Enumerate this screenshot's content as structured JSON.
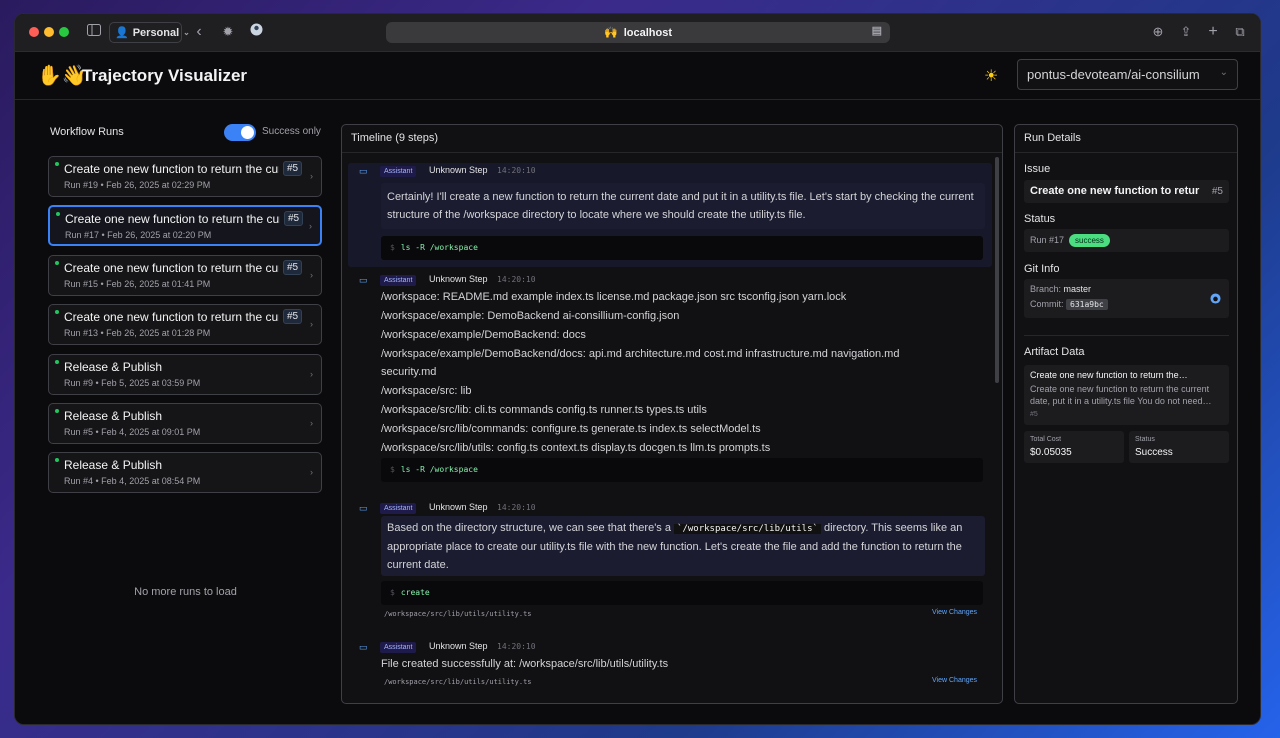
{
  "browser": {
    "profile": "Personal",
    "address": "localhost",
    "address_emoji": "🙌"
  },
  "app": {
    "logo": "✋👋",
    "title": "Trajectory Visualizer",
    "repo": "pontus-devoteam/ai-consilium"
  },
  "runs_panel": {
    "title": "Workflow Runs",
    "toggle_label": "Success only",
    "toggle_on": true,
    "runs": [
      {
        "title": "Create one new function to return the current date",
        "badge": "#5",
        "meta": "Run #19 • Feb 26, 2025 at 02:29 PM",
        "selected": false
      },
      {
        "title": "Create one new function to return the current date",
        "badge": "#5",
        "meta": "Run #17 • Feb 26, 2025 at 02:20 PM",
        "selected": true
      },
      {
        "title": "Create one new function to return the current date",
        "badge": "#5",
        "meta": "Run #15 • Feb 26, 2025 at 01:41 PM",
        "selected": false
      },
      {
        "title": "Create one new function to return the current date",
        "badge": "#5",
        "meta": "Run #13 • Feb 26, 2025 at 01:28 PM",
        "selected": false
      },
      {
        "title": "Release & Publish",
        "badge": "",
        "meta": "Run #9 • Feb 5, 2025 at 03:59 PM",
        "selected": false
      },
      {
        "title": "Release & Publish",
        "badge": "",
        "meta": "Run #5 • Feb 4, 2025 at 09:01 PM",
        "selected": false
      },
      {
        "title": "Release & Publish",
        "badge": "",
        "meta": "Run #4 • Feb 4, 2025 at 08:54 PM",
        "selected": false
      }
    ],
    "footer": "No more runs to load"
  },
  "timeline": {
    "title": "Timeline (9 steps)",
    "steps": [
      {
        "role": "Assistant",
        "name": "Unknown Step",
        "time": "14:20:10",
        "text": "Certainly! I'll create a new function to return the current date and put it in a utility.ts file. Let's start by checking the current structure of the /workspace directory to locate where we should create the utility.ts file.",
        "command": "ls -R /workspace"
      },
      {
        "role": "Assistant",
        "name": "Unknown Step",
        "time": "14:20:10",
        "lines": [
          "/workspace: README.md example index.ts license.md package.json src tsconfig.json yarn.lock",
          "/workspace/example: DemoBackend ai-consillium-config.json",
          "/workspace/example/DemoBackend: docs",
          "/workspace/example/DemoBackend/docs: api.md architecture.md cost.md infrastructure.md navigation.md",
          "security.md",
          "/workspace/src: lib",
          "/workspace/src/lib: cli.ts commands config.ts runner.ts types.ts utils",
          "/workspace/src/lib/commands: configure.ts generate.ts index.ts selectModel.ts",
          "/workspace/src/lib/utils: config.ts context.ts display.ts docgen.ts llm.ts prompts.ts"
        ],
        "command": "ls -R /workspace"
      },
      {
        "role": "Assistant",
        "name": "Unknown Step",
        "time": "14:20:10",
        "text_before": "Based on the directory structure, we can see that there's a",
        "inline_code": "`/workspace/src/lib/utils`",
        "text_after": "directory. This seems like an",
        "text_rest": "appropriate place to create our utility.ts file with the new function. Let's create the file and add the function to return the current date.",
        "command": "create",
        "path": "/workspace/src/lib/utils/utility.ts",
        "link": "View Changes"
      },
      {
        "role": "Assistant",
        "name": "Unknown Step",
        "time": "14:20:10",
        "text": "File created successfully at: /workspace/src/lib/utils/utility.ts",
        "path": "/workspace/src/lib/utils/utility.ts",
        "link": "View Changes"
      }
    ]
  },
  "details": {
    "title": "Run Details",
    "issue_label": "Issue",
    "issue_title": "Create one new function to return the current date",
    "issue_num": "#5",
    "status_label": "Status",
    "status_run": "Run #17",
    "status_value": "success",
    "git_label": "Git Info",
    "branch_label": "Branch:",
    "branch": "master",
    "commit_label": "Commit:",
    "commit": "631a9bc",
    "artifact_label": "Artifact Data",
    "artifact_title": "Create one new function to return the…",
    "artifact_desc": "Create one new function to return the current date, put it in a utility.ts file You do not need…",
    "artifact_num": "#5",
    "cost_label": "Total Cost",
    "cost_value": "$0.05035",
    "status2_label": "Status",
    "status2_value": "Success",
    "colors": {
      "accent": "#3b82f6",
      "success": "#4ade80"
    }
  }
}
